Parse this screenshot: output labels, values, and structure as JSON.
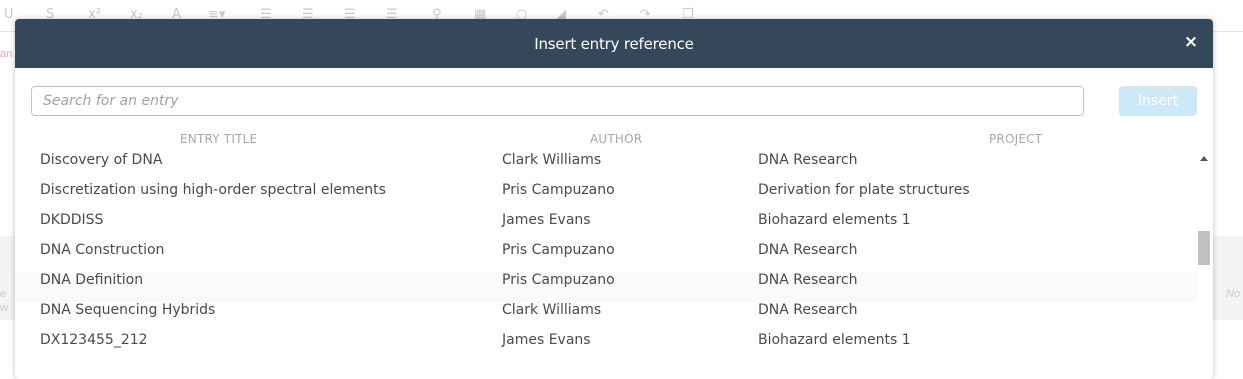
{
  "background": {
    "toolbar_glyphs": [
      "U",
      "S",
      "x²",
      "x₂",
      "A",
      "≡▾",
      "☰",
      "☰",
      "☰",
      "☰",
      "⚲",
      "▦",
      "○",
      "◢",
      "↶",
      "↷",
      "❐"
    ],
    "left_fragments": [
      "an",
      "e",
      "w"
    ],
    "right_fragment": "No"
  },
  "modal": {
    "title": "Insert entry reference",
    "close_label": "×",
    "search_placeholder": "Search for an entry",
    "search_value": "",
    "insert_label": "Insert",
    "columns": {
      "title": "ENTRY TITLE",
      "author": "AUTHOR",
      "project": "PROJECT"
    },
    "rows": [
      {
        "title": "Discovery of DNA",
        "author": "Clark Williams",
        "project": "DNA Research"
      },
      {
        "title": "Discretization using high-order spectral elements",
        "author": "Pris Campuzano",
        "project": "Derivation for plate structures"
      },
      {
        "title": "DKDDISS",
        "author": "James Evans",
        "project": "Biohazard elements 1"
      },
      {
        "title": "DNA Construction",
        "author": "Pris Campuzano",
        "project": "DNA Research"
      },
      {
        "title": "DNA Definition",
        "author": "Pris Campuzano",
        "project": "DNA Research"
      },
      {
        "title": "DNA Sequencing Hybrids",
        "author": "Clark Williams",
        "project": "DNA Research"
      },
      {
        "title": "DX123455_212",
        "author": "James Evans",
        "project": "Biohazard elements 1"
      }
    ]
  },
  "colors": {
    "header_bg": "#35475a",
    "insert_disabled_bg": "#cde8f7"
  }
}
